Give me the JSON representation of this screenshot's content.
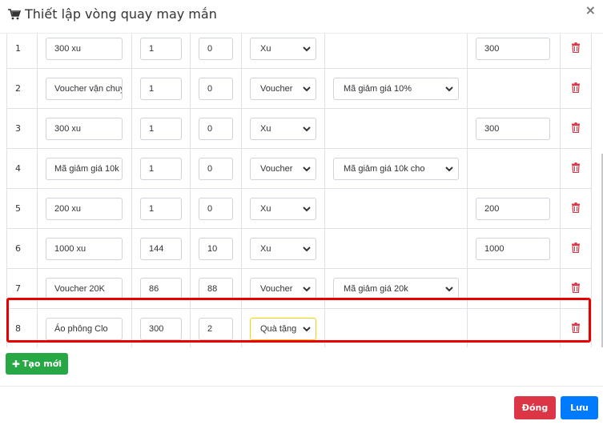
{
  "modal": {
    "title": "Thiết lập vòng quay may mắn",
    "title_icon": "shopping-cart-icon",
    "close_label": "×"
  },
  "colors": {
    "create": "#28a745",
    "close": "#dc3545",
    "save": "#007bff",
    "highlight": "#e60000",
    "trash": "#dc3545"
  },
  "rows": [
    {
      "index": "1",
      "name": "300 xu",
      "qty": "1",
      "won": "0",
      "type": "Xu",
      "voucher": "",
      "xu": "300"
    },
    {
      "index": "2",
      "name": "Voucher vận chuyển",
      "qty": "1",
      "won": "0",
      "type": "Voucher",
      "voucher": "Mã giảm giá 10%",
      "xu": ""
    },
    {
      "index": "3",
      "name": "300 xu",
      "qty": "1",
      "won": "0",
      "type": "Xu",
      "voucher": "",
      "xu": "300"
    },
    {
      "index": "4",
      "name": "Mã giảm giá 10k",
      "qty": "1",
      "won": "0",
      "type": "Voucher",
      "voucher": "Mã giảm giá 10k cho",
      "xu": ""
    },
    {
      "index": "5",
      "name": "200 xu",
      "qty": "1",
      "won": "0",
      "type": "Xu",
      "voucher": "",
      "xu": "200"
    },
    {
      "index": "6",
      "name": "1000 xu",
      "qty": "144",
      "won": "10",
      "type": "Xu",
      "voucher": "",
      "xu": "1000"
    },
    {
      "index": "7",
      "name": "Voucher 20K",
      "qty": "86",
      "won": "88",
      "type": "Voucher",
      "voucher": "Mã giảm giá 20k",
      "xu": ""
    },
    {
      "index": "8",
      "name": "Áo phông Clo",
      "qty": "300",
      "won": "2",
      "type": "Quà tặng",
      "voucher": "",
      "xu": "",
      "highlighted": true
    }
  ],
  "buttons": {
    "create_label": "Tạo mới",
    "close_label": "Đóng",
    "save_label": "Lưu"
  }
}
